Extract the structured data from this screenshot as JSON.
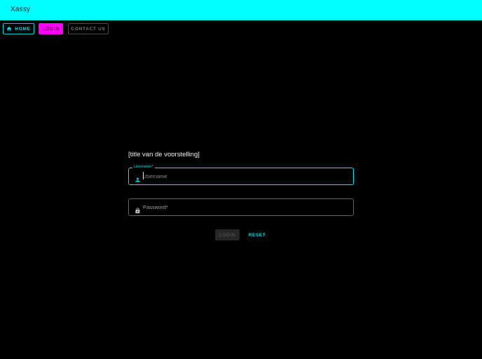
{
  "app": {
    "title": "Xassy"
  },
  "nav": {
    "home_label": "HOME",
    "login_label": "LOGIN",
    "contact_label": "CONTACT US"
  },
  "form": {
    "title": "[title van de voorstelling]",
    "username": {
      "label": "Username*",
      "placeholder": "Username",
      "icon": "person-icon"
    },
    "password": {
      "placeholder": "Password*",
      "icon": "lock-icon"
    },
    "login_label": "LOGIN",
    "reset_label": "RESET"
  },
  "colors": {
    "accent": "#00ffff",
    "brand_highlight": "#ff00ff",
    "background": "#000000"
  }
}
